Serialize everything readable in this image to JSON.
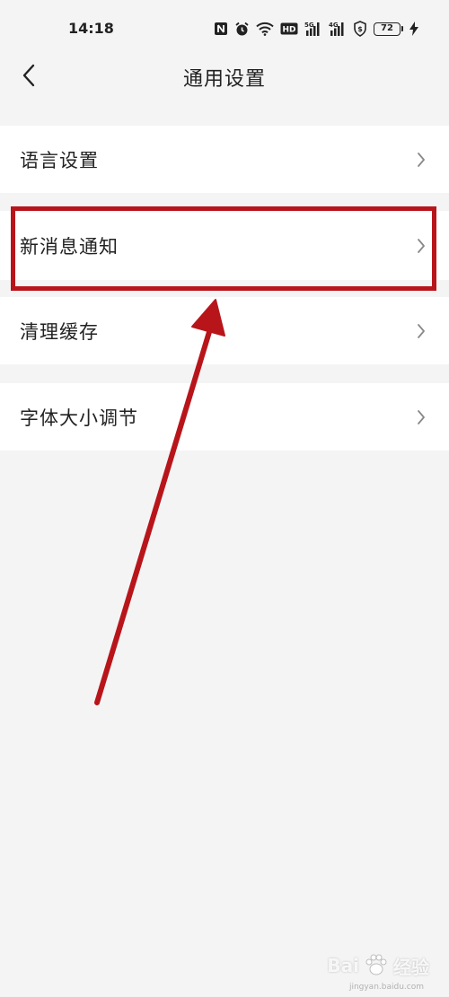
{
  "status_bar": {
    "time": "14:18",
    "icons": [
      "nfc-icon",
      "alarm-icon",
      "wifi-icon",
      "hd-icon",
      "signal-5g-icon",
      "signal-4g-icon",
      "shield-icon",
      "battery-icon",
      "charging-icon"
    ],
    "hd_label": "HD",
    "net1_label": "5G",
    "net2_label": "4G",
    "battery_level": "72"
  },
  "header": {
    "title": "通用设置"
  },
  "settings": {
    "items": [
      {
        "label": "语言设置"
      },
      {
        "label": "新消息通知"
      },
      {
        "label": "清理缓存"
      },
      {
        "label": "字体大小调节"
      }
    ]
  },
  "annotation": {
    "highlight_color": "#b8151b",
    "highlighted_item": "新消息通知"
  },
  "watermark": {
    "brand": "Bai",
    "brand_tail": "经验",
    "url": "jingyan.baidu.com"
  }
}
